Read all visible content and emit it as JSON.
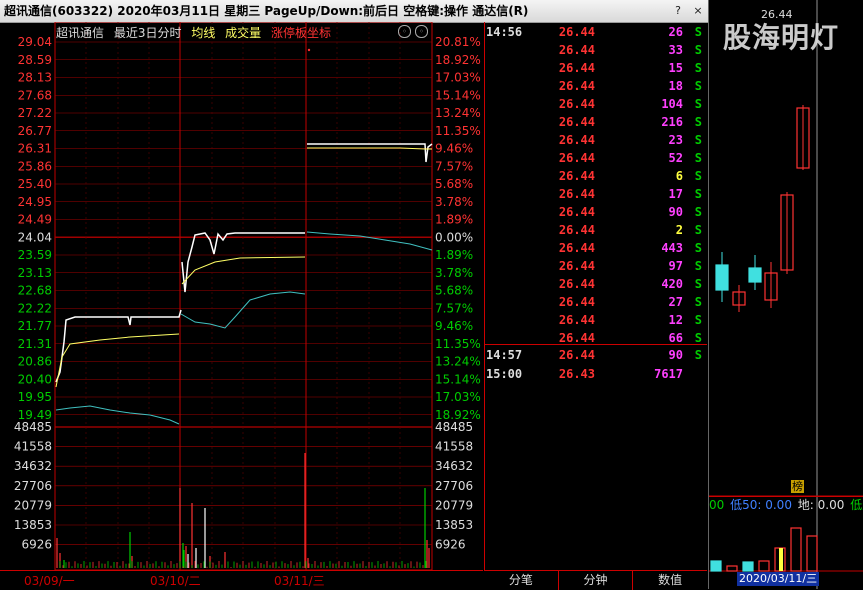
{
  "window": {
    "title": "超讯通信(603322)  2020年03月11日  星期三  PageUp/Down:前后日  空格键:操作  通达信(R)",
    "btn_help": "?",
    "btn_close": "×"
  },
  "chart_header": {
    "stock": "超讯通信",
    "period": "最近3日分时",
    "avg_line": "均线",
    "volume": "成交量",
    "limit_axis": "涨停板坐标"
  },
  "colors": {
    "up": "#ff3333",
    "down": "#00cc00",
    "grid": "#c00000",
    "price": "#ffffff",
    "avg": "#ffff66",
    "prev": "#40c0c0"
  },
  "price_axis": {
    "prices": [
      "29.04",
      "28.59",
      "28.13",
      "27.68",
      "27.22",
      "26.77",
      "26.31",
      "25.86",
      "25.40",
      "24.95",
      "24.49",
      "24.04",
      "23.59",
      "23.13",
      "22.68",
      "22.22",
      "21.77",
      "21.31",
      "20.86",
      "20.40",
      "19.95",
      "19.49"
    ],
    "percents": [
      "20.81%",
      "18.92%",
      "17.03%",
      "15.14%",
      "13.24%",
      "11.35%",
      "9.46%",
      "7.57%",
      "5.68%",
      "3.78%",
      "1.89%",
      "0.00%",
      "1.89%",
      "3.78%",
      "5.68%",
      "7.57%",
      "9.46%",
      "11.35%",
      "13.24%",
      "15.14%",
      "17.03%",
      "18.92%"
    ]
  },
  "volume_axis": {
    "left": [
      "48485",
      "41558",
      "34632",
      "27706",
      "20779",
      "13853",
      "6926"
    ],
    "right": [
      "48485",
      "41558",
      "34632",
      "27706",
      "20779",
      "13853",
      "6926"
    ]
  },
  "dates": [
    "03/09/一",
    "03/10/二",
    "03/11/三"
  ],
  "ticks": [
    {
      "time": "14:56",
      "price": "26.44",
      "vol": "26",
      "vc": "#ff40ff",
      "side": "S"
    },
    {
      "time": "",
      "price": "26.44",
      "vol": "33",
      "vc": "#ff40ff",
      "side": "S"
    },
    {
      "time": "",
      "price": "26.44",
      "vol": "15",
      "vc": "#ff40ff",
      "side": "S"
    },
    {
      "time": "",
      "price": "26.44",
      "vol": "18",
      "vc": "#ff40ff",
      "side": "S"
    },
    {
      "time": "",
      "price": "26.44",
      "vol": "104",
      "vc": "#ff40ff",
      "side": "S"
    },
    {
      "time": "",
      "price": "26.44",
      "vol": "216",
      "vc": "#ff40ff",
      "side": "S"
    },
    {
      "time": "",
      "price": "26.44",
      "vol": "23",
      "vc": "#ff40ff",
      "side": "S"
    },
    {
      "time": "",
      "price": "26.44",
      "vol": "52",
      "vc": "#ff40ff",
      "side": "S"
    },
    {
      "time": "",
      "price": "26.44",
      "vol": "6",
      "vc": "#ffff40",
      "side": "S"
    },
    {
      "time": "",
      "price": "26.44",
      "vol": "17",
      "vc": "#ff40ff",
      "side": "S"
    },
    {
      "time": "",
      "price": "26.44",
      "vol": "90",
      "vc": "#ff40ff",
      "side": "S"
    },
    {
      "time": "",
      "price": "26.44",
      "vol": "2",
      "vc": "#ffff40",
      "side": "S"
    },
    {
      "time": "",
      "price": "26.44",
      "vol": "443",
      "vc": "#ff40ff",
      "side": "S"
    },
    {
      "time": "",
      "price": "26.44",
      "vol": "97",
      "vc": "#ff40ff",
      "side": "S"
    },
    {
      "time": "",
      "price": "26.44",
      "vol": "420",
      "vc": "#ff40ff",
      "side": "S"
    },
    {
      "time": "",
      "price": "26.44",
      "vol": "27",
      "vc": "#ff40ff",
      "side": "S"
    },
    {
      "time": "",
      "price": "26.44",
      "vol": "12",
      "vc": "#ff40ff",
      "side": "S"
    },
    {
      "time": "",
      "price": "26.44",
      "vol": "66",
      "vc": "#ff40ff",
      "side": "S"
    },
    {
      "time": "14:57",
      "price": "26.44",
      "vol": "90",
      "vc": "#ff40ff",
      "side": "S"
    },
    {
      "time": "15:00",
      "price": "26.43",
      "vol": "7617",
      "vc": "#ff40ff",
      "side": ""
    }
  ],
  "tabs": [
    "分笔",
    "分钟",
    "数值"
  ],
  "right_panel": {
    "watermark": "股海明灯",
    "price_label": "26.44",
    "bang": "榜",
    "ind_00": "00",
    "ind_low50": "低50: 0.00",
    "ind_di": "地: 0.00",
    "ind_low": "低量",
    "date": "2020/03/11/三"
  }
}
